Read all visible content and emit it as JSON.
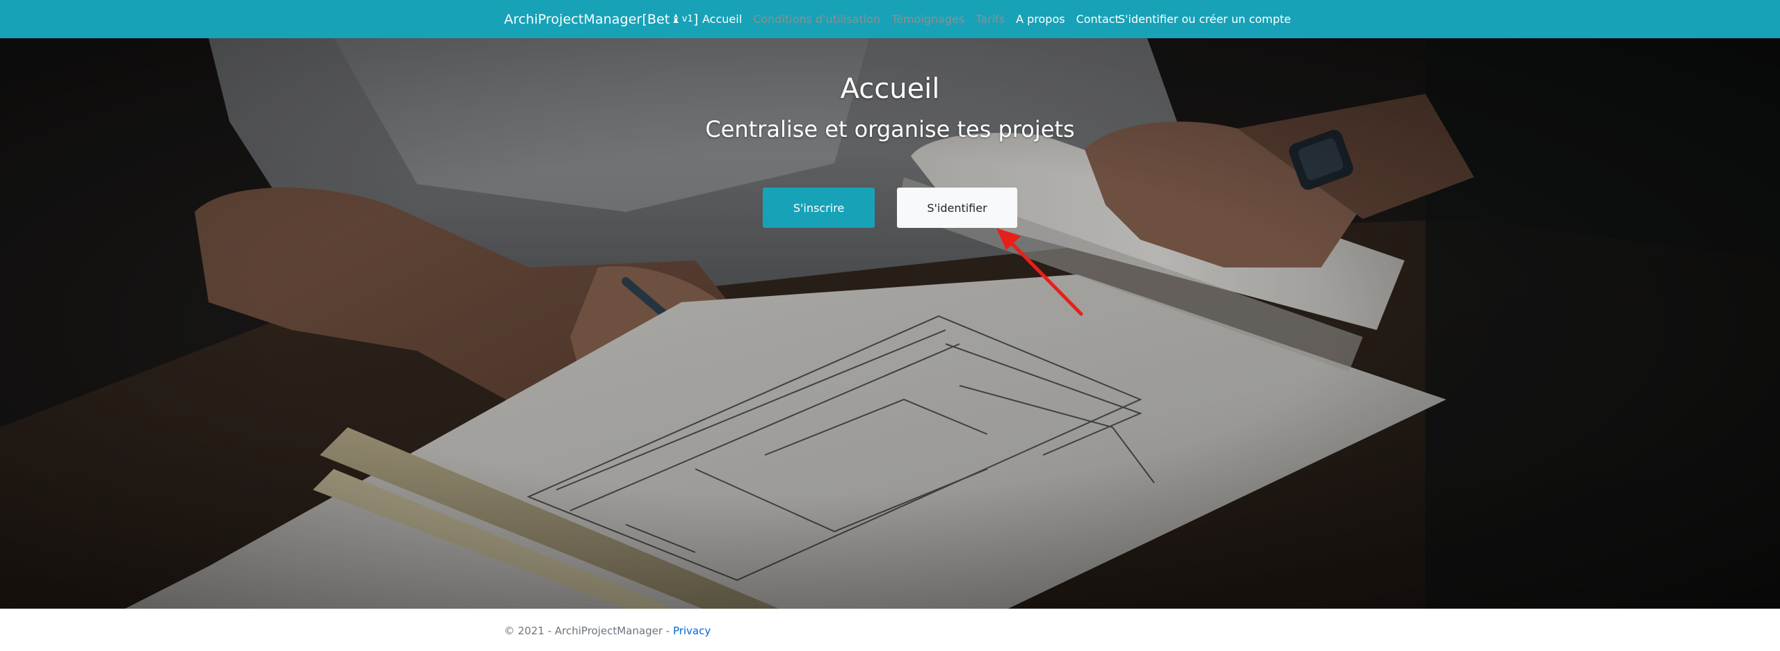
{
  "navbar": {
    "brand": {
      "name": "ArchiProjectManager[Bet",
      "glyph": "♝",
      "version": "v1",
      "close": "]"
    },
    "links": [
      {
        "label": "Accueil",
        "muted": false
      },
      {
        "label": "Conditions d'utilisation",
        "muted": true
      },
      {
        "label": "Témoignages",
        "muted": true
      },
      {
        "label": "Tarifs",
        "muted": true
      },
      {
        "label": "A propos",
        "muted": false
      },
      {
        "label": "Contact",
        "muted": false
      }
    ],
    "login_label": "S'identifier ou créer un compte"
  },
  "hero": {
    "title": "Accueil",
    "subtitle": "Centralise et organise tes projets",
    "signup_label": "S'inscrire",
    "login_label": "S'identifier",
    "annotation_arrow_color": "#e8201a"
  },
  "footer": {
    "copyright": "© 2021 - ArchiProjectManager - ",
    "privacy_label": "Privacy"
  },
  "colors": {
    "accent": "#17a2b8",
    "light_button": "#f8f9fa",
    "footer_link": "#0366d6"
  }
}
